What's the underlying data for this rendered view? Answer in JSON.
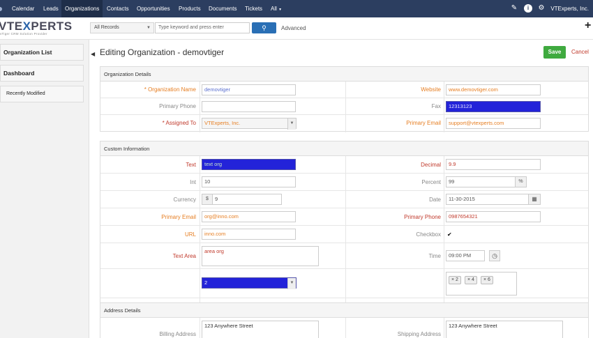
{
  "nav": {
    "items": [
      "Calendar",
      "Leads",
      "Organizations",
      "Contacts",
      "Opportunities",
      "Products",
      "Documents",
      "Tickets",
      "All"
    ],
    "user": "VTExperts, Inc."
  },
  "logo": {
    "brand_a": "VTE",
    "brand_x": "X",
    "brand_b": "PERTS",
    "tagline": "vTiger CRM Solution Provider"
  },
  "search": {
    "records": "All Records",
    "placeholder": "Type keyword and press enter",
    "advanced": "Advanced"
  },
  "sidebar": {
    "items": [
      "Organization List",
      "Dashboard",
      "Recently Modified"
    ]
  },
  "page": {
    "title": "Editing Organization - demovtiger",
    "save": "Save",
    "cancel": "Cancel"
  },
  "org": {
    "header": "Organization Details",
    "name_label": "* Organization Name",
    "name_value": "demovtiger",
    "website_label": "Website",
    "website_value": "www.demovtiger.com",
    "phone_label": "Primary Phone",
    "phone_value": "",
    "fax_label": "Fax",
    "fax_value": "12313123",
    "assigned_label": "* Assigned To",
    "assigned_value": "VTExperts, Inc.",
    "email_label": "Primary Email",
    "email_value": "support@vtexperts.com"
  },
  "custom": {
    "header": "Custom Information",
    "text_label": "Text",
    "text_value": "text org",
    "decimal_label": "Decimal",
    "decimal_value": "9.9",
    "int_label": "Int",
    "int_value": "10",
    "percent_label": "Percent",
    "percent_value": "99",
    "percent_sign": "%",
    "currency_label": "Currency",
    "currency_sign": "$",
    "currency_value": "9",
    "date_label": "Date",
    "date_value": "11-30-2015",
    "email_label": "Primary Email",
    "email_value": "org@inno.com",
    "phone_label": "Primary Phone",
    "phone_value": "0987654321",
    "url_label": "URL",
    "url_value": "inno.com",
    "checkbox_label": "Checkbox",
    "checkbox_mark": "✔",
    "textarea_label": "Text Area",
    "textarea_value": "area org",
    "time_label": "Time",
    "time_value": "09:00 PM",
    "picklist_value": "2",
    "multi_tags": [
      "2",
      "4",
      "6"
    ]
  },
  "address": {
    "header": "Address Details",
    "billing_label": "Billing Address",
    "billing_value": "123 Anywhere Street",
    "shipping_label": "Shipping Address",
    "shipping_value": "123 Anywhere Street"
  }
}
